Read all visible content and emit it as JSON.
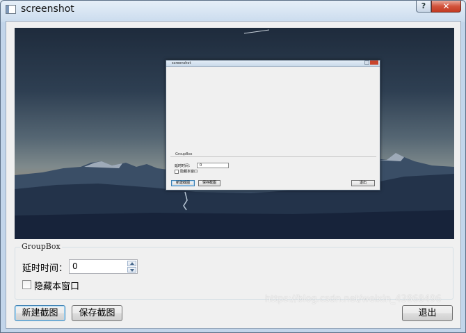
{
  "window": {
    "title": "screenshot",
    "help_button": "?",
    "close_button": "✕"
  },
  "preview": {
    "mini_window": {
      "title": "screenshot",
      "group_title": "GroupBox",
      "delay_label": "延时时间：",
      "delay_value": "0",
      "hide_label": "隐藏本窗口",
      "new_button": "新建截图",
      "save_button": "保存截图",
      "exit_button": "退出"
    }
  },
  "groupbox": {
    "title": "GroupBox",
    "delay_label": "延时时间：",
    "delay_value": "0",
    "hide_window_label": "隐藏本窗口",
    "hide_window_checked": false
  },
  "buttons": {
    "new_screenshot": "新建截图",
    "save_screenshot": "保存截图",
    "exit": "退出"
  },
  "watermark": "https://blog.csdn.net/weixin_43868496",
  "icons": {
    "app": "window-icon",
    "help": "help-icon",
    "close": "close-icon",
    "spin_up": "arrow-up-icon",
    "spin_down": "arrow-down-icon"
  }
}
